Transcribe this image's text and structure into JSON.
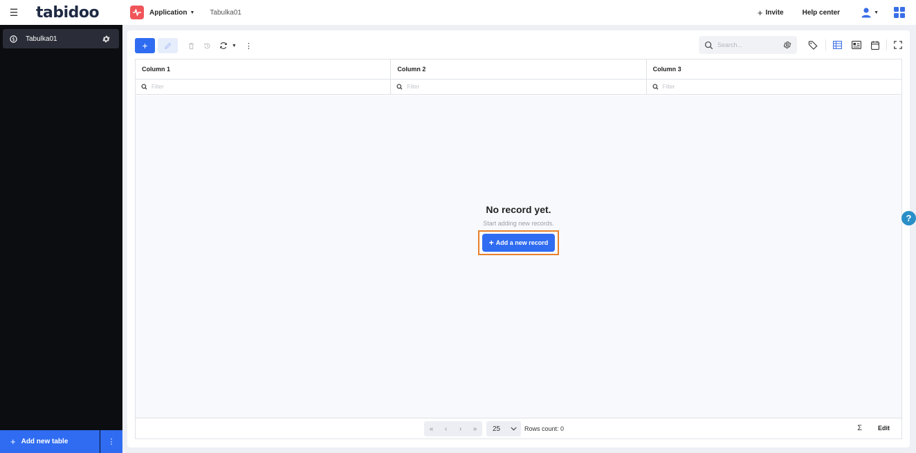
{
  "header": {
    "logo": "tabidoo",
    "app_name": "Application",
    "breadcrumb_table": "Tabulka01",
    "invite_label": "Invite",
    "help_center_label": "Help center"
  },
  "sidebar": {
    "items": [
      {
        "label": "Tabulka01"
      }
    ],
    "add_table_label": "Add new table"
  },
  "search": {
    "placeholder": "Search..."
  },
  "grid": {
    "columns": [
      "Column 1",
      "Column 2",
      "Column 3"
    ],
    "filter_placeholder": "Filter",
    "empty_title": "No record yet.",
    "empty_subtitle": "Start adding new records.",
    "add_record_label": "Add a new record"
  },
  "footer": {
    "page_size": "25",
    "rows_count": "Rows count: 0",
    "sigma": "Σ",
    "edit_label": "Edit"
  },
  "colors": {
    "accent": "#2f6cf1",
    "sidebar_bg": "#0c0d10",
    "highlight": "#e8812a",
    "app_icon": "#f0555a"
  },
  "icons": [
    "menu-icon",
    "app-pulse-icon",
    "plus-icon",
    "user-icon",
    "apps-grid-icon",
    "table-icon",
    "gear-icon",
    "pencil-icon",
    "trash-icon",
    "history-icon",
    "refresh-icon",
    "more-vertical-icon",
    "search-icon",
    "tag-icon",
    "grid-view-icon",
    "card-view-icon",
    "calendar-icon",
    "fullscreen-icon",
    "first-page-icon",
    "prev-page-icon",
    "next-page-icon",
    "last-page-icon",
    "chevron-down-icon",
    "help-icon"
  ]
}
